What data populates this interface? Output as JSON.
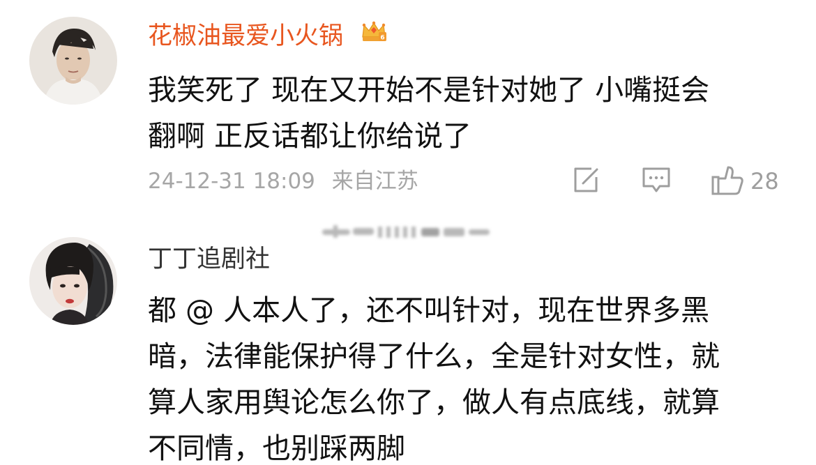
{
  "comments": [
    {
      "username": "花椒油最爱小火锅",
      "badge_icon": "vip-crown-icon",
      "content_lines": [
        "我笑死了 现在又开始不是针对她了 小嘴挺会",
        "翻啊 正反话都让你给说了"
      ],
      "timestamp": "24-12-31 18:09",
      "location": "来自江苏",
      "actions": {
        "share_icon": "share-icon",
        "reply_icon": "comment-icon",
        "like_icon": "thumbs-up-icon",
        "like_count": "28"
      }
    },
    {
      "username": "丁丁追剧社",
      "content_lines": [
        "都 @ 人本人了，还不叫针对，现在世界多黑",
        "暗，法律能保护得了什么，全是针对女性，就",
        "算人家用舆论怎么你了，做人有点底线，就算",
        "不同情，也别踩两脚"
      ]
    }
  ],
  "colors": {
    "vip_name": "#e8561f",
    "normal_name": "#333333",
    "text": "#111111",
    "meta": "#a6a6a6"
  }
}
